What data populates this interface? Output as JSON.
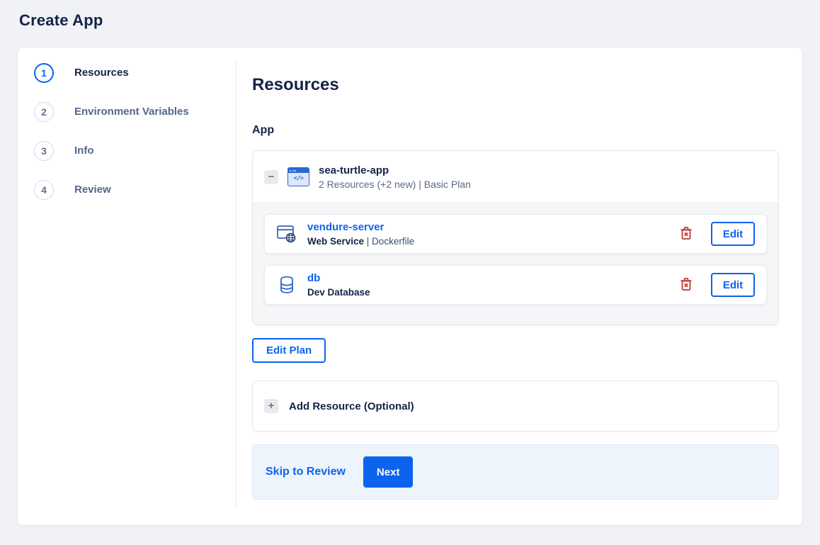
{
  "page": {
    "title": "Create App"
  },
  "stepper": {
    "steps": [
      {
        "number": "1",
        "label": "Resources"
      },
      {
        "number": "2",
        "label": "Environment Variables"
      },
      {
        "number": "3",
        "label": "Info"
      },
      {
        "number": "4",
        "label": "Review"
      }
    ]
  },
  "content": {
    "heading": "Resources",
    "app_section_label": "App",
    "app": {
      "name": "sea-turtle-app",
      "summary": "2 Resources (+2 new) | Basic Plan",
      "collapse_glyph": "−",
      "icon_glyph": "</>",
      "resources": [
        {
          "name": "vendure-server",
          "type": "Web Service",
          "type_suffix": " | Dockerfile",
          "icon": "web-service-icon",
          "edit_label": "Edit"
        },
        {
          "name": "db",
          "type": "Dev Database",
          "type_suffix": "",
          "icon": "database-icon",
          "edit_label": "Edit"
        }
      ]
    },
    "edit_plan_label": "Edit Plan",
    "add_resource": {
      "glyph": "+",
      "label": "Add Resource (Optional)"
    },
    "footer": {
      "skip_label": "Skip to Review",
      "next_label": "Next"
    }
  },
  "colors": {
    "primary_blue": "#0C64EE",
    "danger_red": "#C0362C",
    "heading_navy": "#152347",
    "muted_gray": "#5B6B84",
    "page_background": "#F0F2F6",
    "footer_background": "#EEF4FB"
  }
}
